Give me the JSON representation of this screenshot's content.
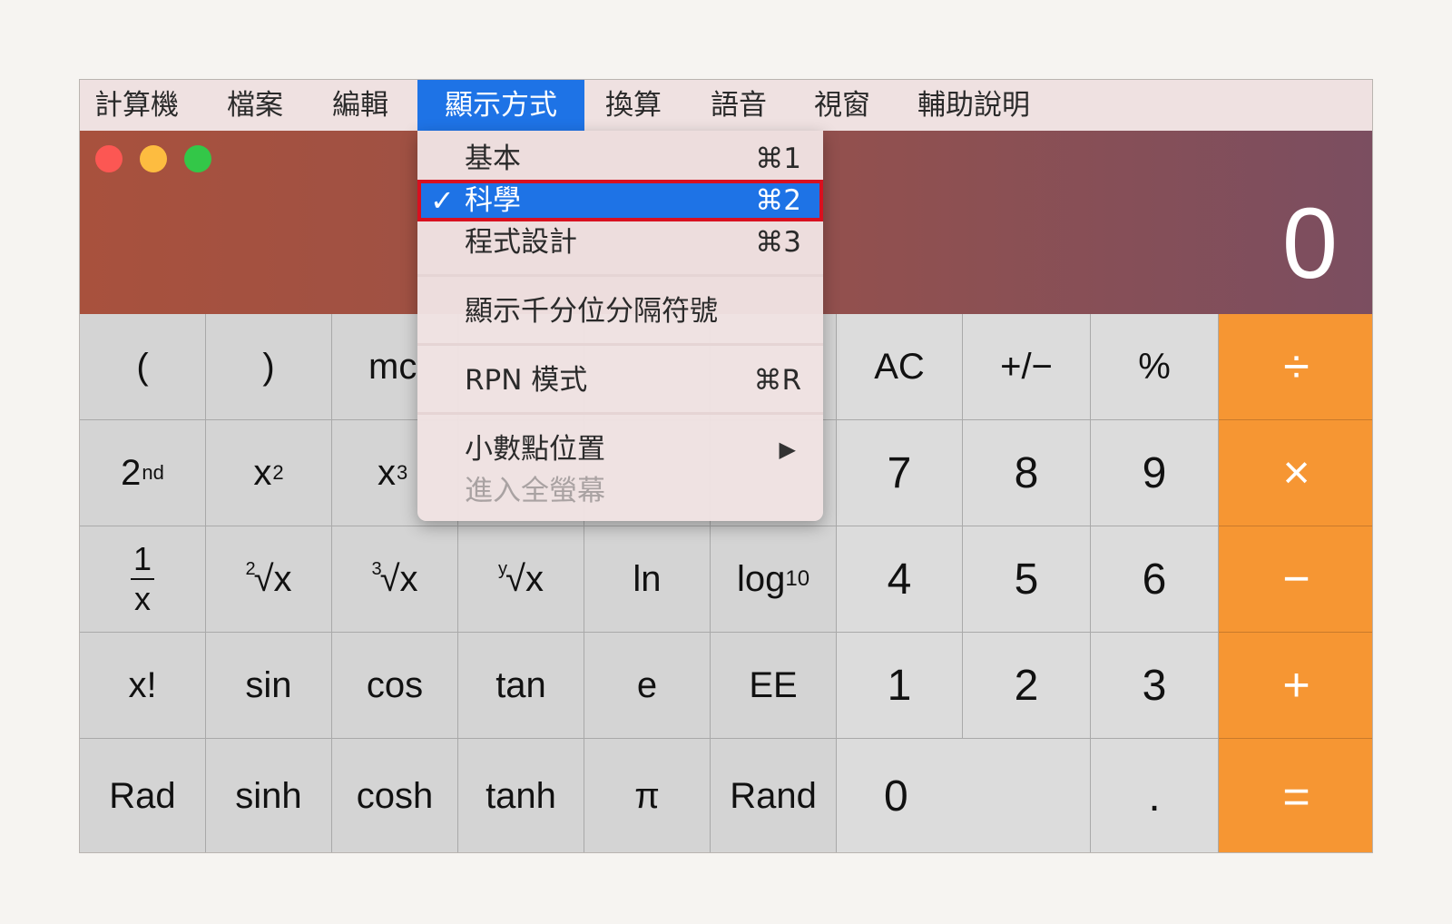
{
  "menubar": {
    "items": [
      {
        "label": "計算機"
      },
      {
        "label": "檔案"
      },
      {
        "label": "編輯"
      },
      {
        "label": "顯示方式"
      },
      {
        "label": "換算"
      },
      {
        "label": "語音"
      },
      {
        "label": "視窗"
      },
      {
        "label": "輔助說明"
      }
    ],
    "active_index": 3
  },
  "window_controls": {
    "close_color": "#fc5753",
    "minimize_color": "#fdbc40",
    "zoom_color": "#33c748"
  },
  "display": {
    "value": "0"
  },
  "view_menu": {
    "items": [
      {
        "label": "基本",
        "shortcut": "⌘1"
      },
      {
        "label": "科學",
        "shortcut": "⌘2",
        "checkmark": "✓"
      },
      {
        "label": "程式設計",
        "shortcut": "⌘3"
      },
      {
        "label": "顯示千分位分隔符號"
      },
      {
        "label": "RPN 模式",
        "shortcut": "⌘R"
      },
      {
        "label": "小數點位置",
        "submenu_arrow": "▶"
      },
      {
        "label": "進入全螢幕"
      }
    ],
    "selected_index": 1
  },
  "keys": {
    "paren_open": "(",
    "paren_close": ")",
    "mc_partial": "mc",
    "ac": "AC",
    "plus_minus": "+/−",
    "percent": "%",
    "divide": "÷",
    "second": "2",
    "second_sup": "nd",
    "x_squared": "x",
    "x_squared_sup": "2",
    "x_cubed": "x",
    "x_cubed_sup": "3",
    "seven": "7",
    "eight": "8",
    "nine": "9",
    "multiply": "×",
    "reciprocal_num": "1",
    "reciprocal_den": "x",
    "sqrt2_index": "2",
    "sqrt2": "√x",
    "sqrt3_index": "3",
    "sqrt3": "√x",
    "sqrty_index": "y",
    "sqrty": "√x",
    "ln": "ln",
    "log10": "log",
    "log10_sub": "10",
    "four": "4",
    "five": "5",
    "six": "6",
    "minus": "−",
    "factorial": "x!",
    "sin": "sin",
    "cos": "cos",
    "tan": "tan",
    "e": "e",
    "ee": "EE",
    "one": "1",
    "two": "2",
    "three": "3",
    "plus": "+",
    "rad": "Rad",
    "sinh": "sinh",
    "cosh": "cosh",
    "tanh": "tanh",
    "pi": "π",
    "rand": "Rand",
    "zero": "0",
    "decimal": ".",
    "equals": "="
  }
}
